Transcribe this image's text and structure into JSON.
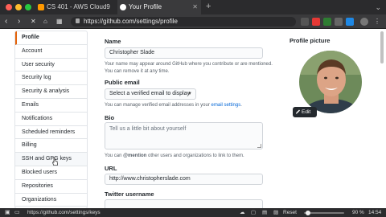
{
  "browser": {
    "tabs": [
      {
        "label": "CS 401 - AWS Cloud9",
        "active": false
      },
      {
        "label": "Your Profile",
        "active": true
      }
    ],
    "url": "https://github.com/settings/profile"
  },
  "sidebar": {
    "items": [
      {
        "label": "Profile",
        "selected": true
      },
      {
        "label": "Account"
      },
      {
        "label": "User security"
      },
      {
        "label": "Security log"
      },
      {
        "label": "Security & analysis"
      },
      {
        "label": "Emails"
      },
      {
        "label": "Notifications"
      },
      {
        "label": "Scheduled reminders"
      },
      {
        "label": "Billing"
      },
      {
        "label": "SSH and GPG keys",
        "hover": true
      },
      {
        "label": "Blocked users"
      },
      {
        "label": "Repositories"
      },
      {
        "label": "Organizations"
      }
    ]
  },
  "form": {
    "name_label": "Name",
    "name_value": "Christopher Slade",
    "name_note": "Your name may appear around GitHub where you contribute or are mentioned. You can remove it at any time.",
    "public_email_label": "Public email",
    "public_email_select": "Select a verified email to display",
    "public_email_note_prefix": "You can manage verified email addresses in your ",
    "public_email_note_link": "email settings",
    "public_email_note_suffix": ".",
    "bio_label": "Bio",
    "bio_placeholder": "Tell us a little bit about yourself",
    "bio_note_prefix": "You can ",
    "bio_note_mention": "@mention",
    "bio_note_suffix": " other users and organizations to link to them.",
    "url_label": "URL",
    "url_value": "http://www.christopherslade.com",
    "twitter_label": "Twitter username"
  },
  "profile_picture": {
    "label": "Profile picture",
    "edit_label": "Edit"
  },
  "statusbar": {
    "hover_url": "https://github.com/settings/keys",
    "reset_label": "Reset",
    "zoom": "90 %",
    "time": "14:54"
  }
}
